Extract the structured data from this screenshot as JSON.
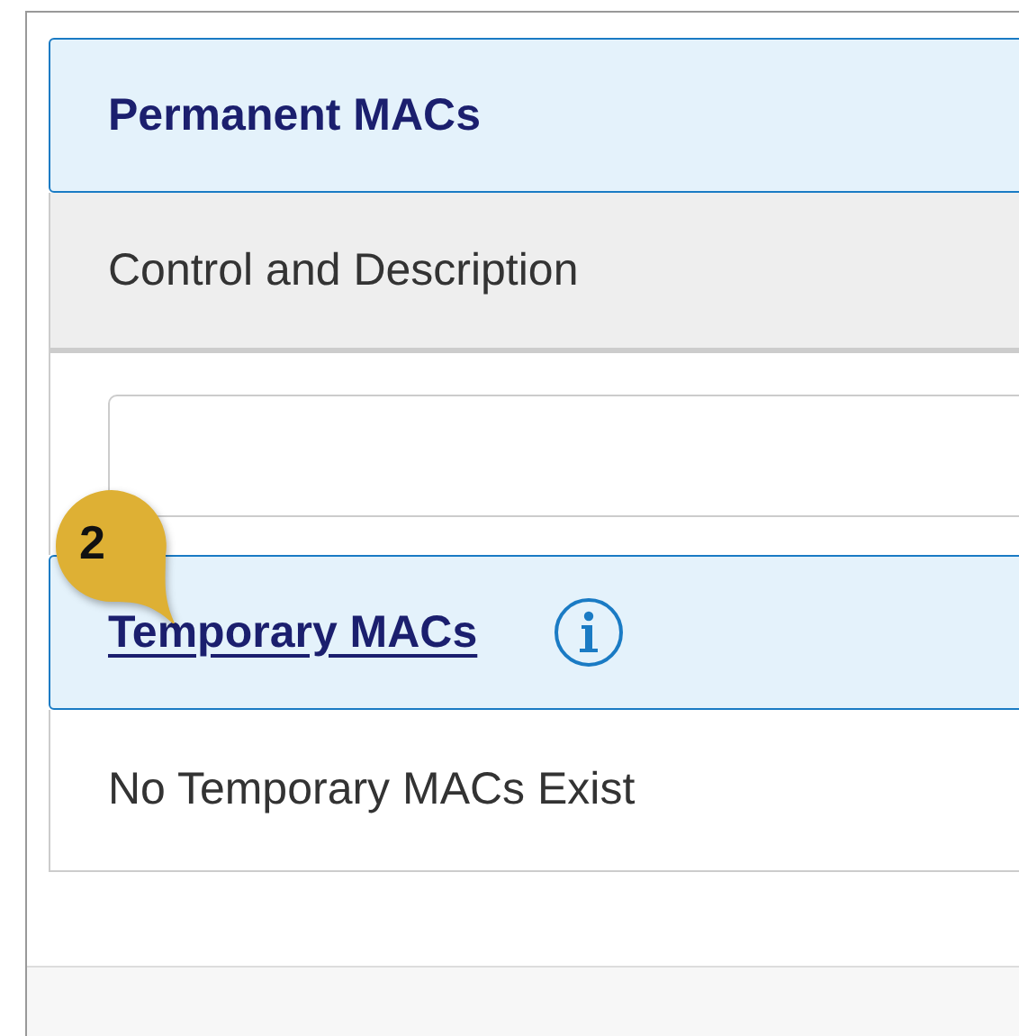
{
  "permanent_section": {
    "title": "Permanent MACs",
    "column_header": "Control and Description"
  },
  "temporary_section": {
    "title": "Temporary MACs",
    "empty_message": "No Temporary MACs Exist"
  },
  "callout": {
    "number": "2"
  }
}
